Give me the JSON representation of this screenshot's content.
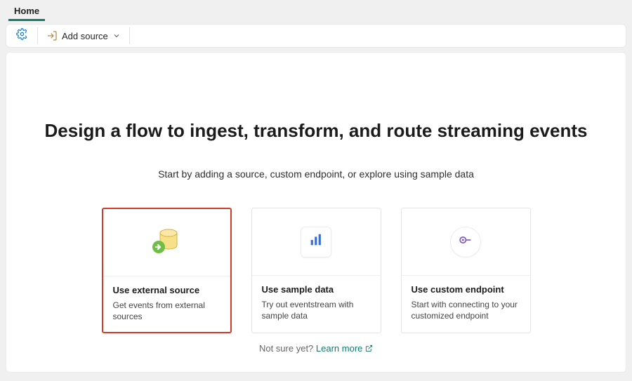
{
  "tabs": {
    "home": "Home"
  },
  "toolbar": {
    "addSource": "Add source"
  },
  "main": {
    "title": "Design a flow to ingest, transform, and route streaming events",
    "subtitle": "Start by adding a source, custom endpoint, or explore using sample data"
  },
  "cards": {
    "external": {
      "title": "Use external source",
      "desc": "Get events from external sources"
    },
    "sample": {
      "title": "Use sample data",
      "desc": "Try out eventstream with sample data"
    },
    "endpoint": {
      "title": "Use custom endpoint",
      "desc": "Start with connecting to your customized endpoint"
    }
  },
  "footer": {
    "prefix": "Not sure yet? ",
    "link": "Learn more"
  }
}
